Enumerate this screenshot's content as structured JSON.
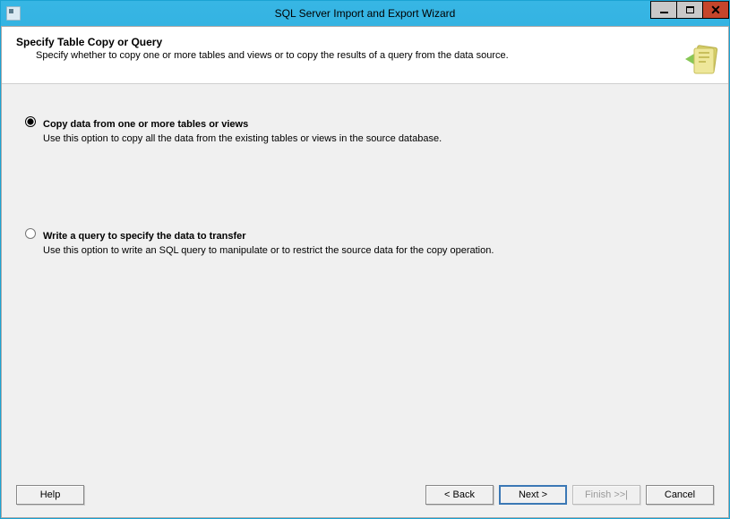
{
  "window": {
    "title": "SQL Server Import and Export Wizard"
  },
  "header": {
    "heading": "Specify Table Copy or Query",
    "subtitle": "Specify whether to copy one or more tables and views or to copy the results of a query from the data source."
  },
  "options": {
    "copy": {
      "label": "Copy data from one or more tables or views",
      "description": "Use this option to copy all the data from the existing tables or views in the source database.",
      "selected": true
    },
    "query": {
      "label": "Write a query to specify the data to transfer",
      "description": "Use this option to write an SQL query to manipulate or to restrict the source data for the copy operation.",
      "selected": false
    }
  },
  "buttons": {
    "help": "Help",
    "back": "< Back",
    "next": "Next >",
    "finish": "Finish >>|",
    "cancel": "Cancel"
  }
}
